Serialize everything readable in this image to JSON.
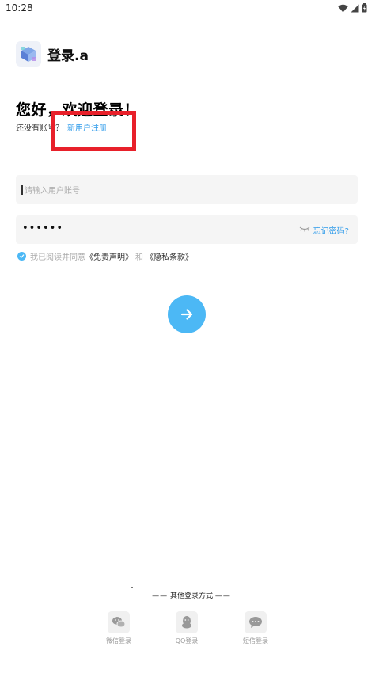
{
  "status_bar": {
    "time": "10:28"
  },
  "app": {
    "name": "登录.a"
  },
  "greeting": "您好，欢迎登录！",
  "register": {
    "prompt": "还没有账号？",
    "link": "新用户注册"
  },
  "account_field": {
    "placeholder": "请输入用户账号"
  },
  "password_field": {
    "value": "••••••",
    "forgot_link": "忘记密码?"
  },
  "agreement": {
    "prefix": "我已阅读并同意",
    "disclaimer": "《免责声明》",
    "joiner": "和",
    "privacy": "《隐私条款》",
    "checked": true
  },
  "other_login": {
    "label": "其他登录方式",
    "dash": "——",
    "options": [
      {
        "label": "微信登录",
        "icon": "wechat-icon"
      },
      {
        "label": "QQ登录",
        "icon": "qq-icon"
      },
      {
        "label": "短信登录",
        "icon": "sms-icon"
      }
    ]
  },
  "colors": {
    "accent": "#4cb8f5",
    "link": "#2e9bea",
    "highlight": "#e8202a"
  }
}
